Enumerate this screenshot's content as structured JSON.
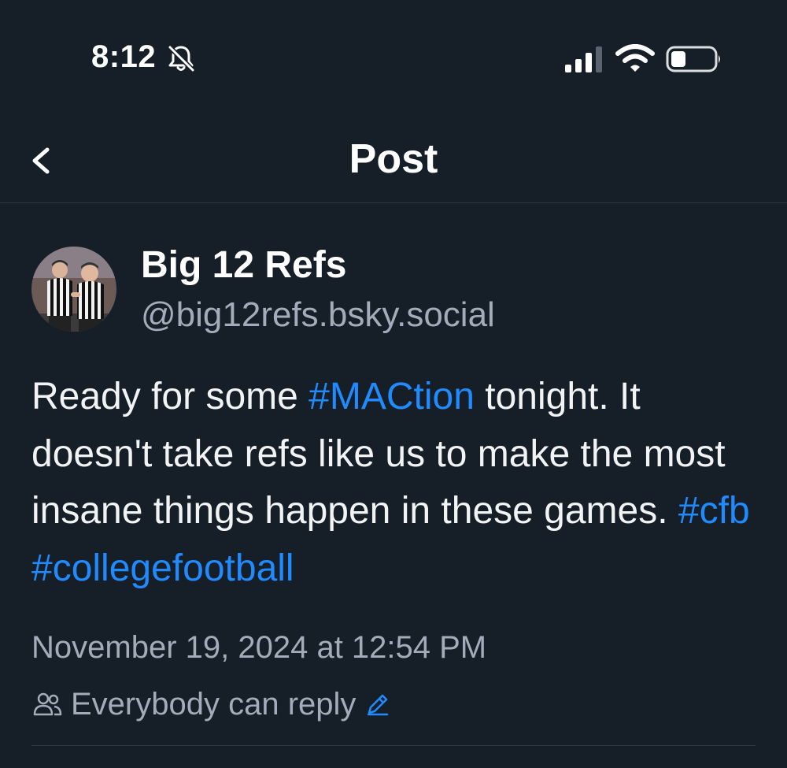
{
  "status_bar": {
    "time": "8:12",
    "icons": [
      "bell-slash-icon",
      "signal-icon",
      "wifi-icon",
      "battery-icon"
    ]
  },
  "header": {
    "title": "Post",
    "back_icon": "chevron-left-icon"
  },
  "post": {
    "author": {
      "display_name": "Big 12 Refs",
      "handle": "@big12refs.bsky.social",
      "avatar": "avatar-two-referees"
    },
    "text_segments": [
      {
        "text": "Ready for some ",
        "hashtag": false
      },
      {
        "text": "#MACtion",
        "hashtag": true
      },
      {
        "text": " tonight. It doesn't take refs like us to make the most insane things happen in these games. ",
        "hashtag": false
      },
      {
        "text": "#cfb",
        "hashtag": true
      },
      {
        "text": " ",
        "hashtag": false
      },
      {
        "text": "#collegefootball",
        "hashtag": true
      }
    ],
    "timestamp": "November 19, 2024 at 12:54 PM",
    "reply_setting": "Everybody can reply",
    "reply_setting_icon": "people-icon",
    "reply_edit_icon": "pencil-icon"
  },
  "colors": {
    "background": "#161e27",
    "text": "#f1f3f5",
    "muted": "#a3adba",
    "link": "#208bfe",
    "divider": "#2c3846"
  }
}
